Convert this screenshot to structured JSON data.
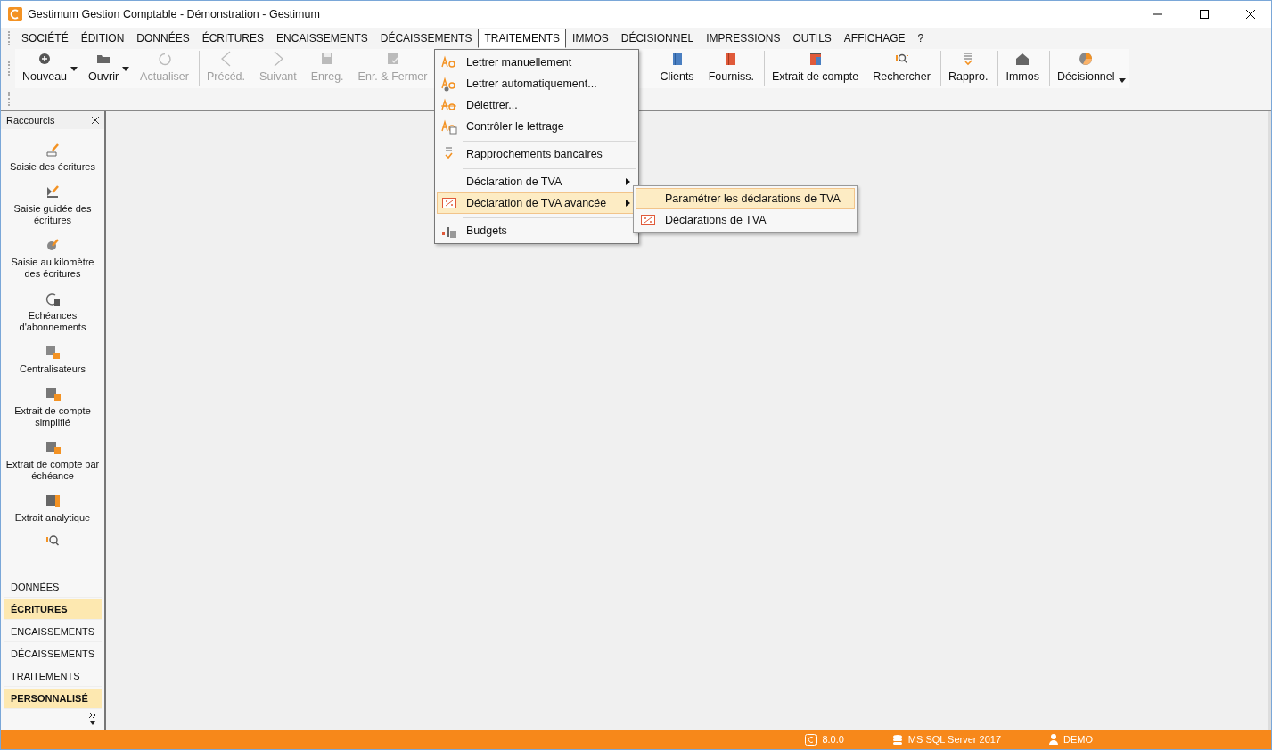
{
  "window": {
    "title": "Gestimum Gestion Comptable - Démonstration - Gestimum"
  },
  "menubar": [
    {
      "label": "SOCIÉTÉ",
      "selected": false
    },
    {
      "label": "ÉDITION",
      "selected": false
    },
    {
      "label": "DONNÉES",
      "selected": false
    },
    {
      "label": "ÉCRITURES",
      "selected": false
    },
    {
      "label": "ENCAISSEMENTS",
      "selected": false
    },
    {
      "label": "DÉCAISSEMENTS",
      "selected": false
    },
    {
      "label": "TRAITEMENTS",
      "selected": true
    },
    {
      "label": "IMMOS",
      "selected": false
    },
    {
      "label": "DÉCISIONNEL",
      "selected": false
    },
    {
      "label": "IMPRESSIONS",
      "selected": false
    },
    {
      "label": "OUTILS",
      "selected": false
    },
    {
      "label": "AFFICHAGE",
      "selected": false
    },
    {
      "label": "?",
      "selected": false
    }
  ],
  "toolbar": [
    {
      "label": "Nouveau",
      "disabled": false,
      "dropdown": true,
      "separator_before": false
    },
    {
      "label": "Ouvrir",
      "disabled": false,
      "dropdown": true,
      "separator_before": false
    },
    {
      "label": "Actualiser",
      "disabled": true,
      "dropdown": false,
      "separator_before": false
    },
    {
      "label": "Précéd.",
      "disabled": true,
      "dropdown": false,
      "separator_before": true
    },
    {
      "label": "Suivant",
      "disabled": true,
      "dropdown": false,
      "separator_before": false
    },
    {
      "label": "Enreg.",
      "disabled": true,
      "dropdown": false,
      "separator_before": false
    },
    {
      "label": "Enr. & Fermer",
      "disabled": true,
      "dropdown": false,
      "separator_before": false
    }
  ],
  "toolbar_right": [
    {
      "label": "Clients",
      "separator_before": false
    },
    {
      "label": "Fourniss.",
      "separator_before": false
    },
    {
      "label": "Extrait de compte",
      "separator_before": true
    },
    {
      "label": "Rechercher",
      "separator_before": false
    },
    {
      "label": "Rappro.",
      "separator_before": true
    },
    {
      "label": "Immos",
      "separator_before": true
    },
    {
      "label": "Décisionnel",
      "separator_before": true
    }
  ],
  "menu": {
    "items": [
      {
        "label": "Lettrer manuellement",
        "separator_before": false,
        "submenu": false,
        "selected": false
      },
      {
        "label": "Lettrer automatiquement...",
        "separator_before": false,
        "submenu": false,
        "selected": false
      },
      {
        "label": "Délettrer...",
        "separator_before": false,
        "submenu": false,
        "selected": false
      },
      {
        "label": "Contrôler le lettrage",
        "separator_before": false,
        "submenu": false,
        "selected": false
      },
      {
        "label": "Rapprochements bancaires",
        "separator_before": true,
        "submenu": false,
        "selected": false
      },
      {
        "label": "Déclaration de TVA",
        "separator_before": true,
        "submenu": true,
        "selected": false
      },
      {
        "label": "Déclaration de TVA avancée",
        "separator_before": false,
        "submenu": true,
        "selected": true
      },
      {
        "label": "Budgets",
        "separator_before": true,
        "submenu": false,
        "selected": false
      }
    ],
    "submenu": [
      {
        "label": "Paramétrer les déclarations de TVA",
        "selected": true
      },
      {
        "label": "Déclarations de TVA",
        "selected": false
      }
    ]
  },
  "sidebar": {
    "title": "Raccourcis",
    "shortcuts": [
      {
        "label": "Saisie des écritures"
      },
      {
        "label": "Saisie guidée des écritures"
      },
      {
        "label": "Saisie au kilomètre des écritures"
      },
      {
        "label": "Echéances d'abonnements"
      },
      {
        "label": "Centralisateurs"
      },
      {
        "label": "Extrait de compte simplifié"
      },
      {
        "label": "Extrait de compte par échéance"
      },
      {
        "label": "Extrait analytique"
      }
    ],
    "sections": [
      {
        "label": "DONNÉES",
        "selected": false
      },
      {
        "label": "ÉCRITURES",
        "selected": true
      },
      {
        "label": "ENCAISSEMENTS",
        "selected": false
      },
      {
        "label": "DÉCAISSEMENTS",
        "selected": false
      },
      {
        "label": "TRAITEMENTS",
        "selected": false
      },
      {
        "label": "PERSONNALISÉ",
        "selected": true
      }
    ]
  },
  "status_bar": {
    "version": "8.0.0",
    "database": "MS SQL Server 2017",
    "user": "DEMO"
  }
}
